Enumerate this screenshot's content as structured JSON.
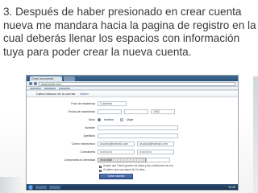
{
  "caption": "3. Después de haber presionado en crear cuenta nueva me mandara hacia la pagina de registro en la cual deberás llenar los espacios con información tuya para poder crear la nueva cuenta.",
  "browser": {
    "tab_label": "Crear una cuenta",
    "url": "www.tuenti.com"
  },
  "page": {
    "header_text": "Datos básicos de la cuenta",
    "header_link": "Volver"
  },
  "form": {
    "fields": [
      {
        "label": "País de residencia",
        "value": "Colombia"
      },
      {
        "label": "Fecha de nacimiento",
        "value": "1992"
      },
      {
        "label": "Nombre",
        "value": ""
      },
      {
        "label": "Apellidos",
        "value": ""
      },
      {
        "label": "Correo electrónico",
        "value": "usuario@hotmail.com"
      },
      {
        "label": "Contraseña",
        "value": "••••••••••••"
      }
    ],
    "sex_label": "Sexo",
    "sex_options": [
      "Hombre",
      "Mujer"
    ],
    "captcha_label": "Comprueba tu identidad",
    "captcha_value": "moccasin",
    "terms": [
      "Acepto que Tuenti guarde mis datos y las condiciones de uso.",
      "Confirmo que soy mayor de 14 años."
    ],
    "submit_label": "Crear cuenta"
  },
  "taskbar": {
    "clock": "10:26"
  },
  "colors": {
    "caption_text": "#3a3a3a",
    "brand": "#3b5998",
    "browser_chrome": "#2d5479"
  }
}
